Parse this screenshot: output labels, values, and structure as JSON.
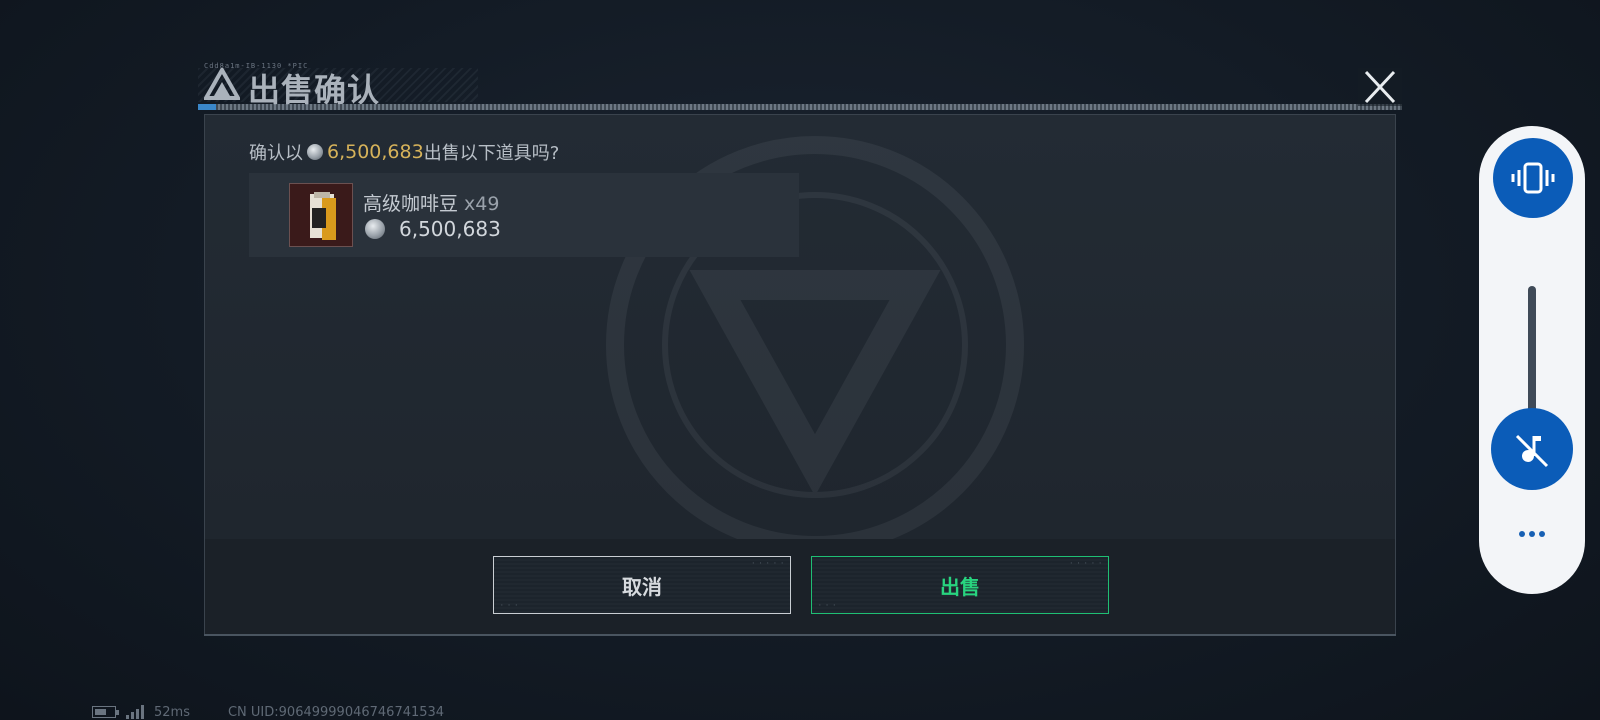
{
  "dialog": {
    "title_tag": "Cdd8a1m-IB-1130 *PIC",
    "title": "出售确认",
    "confirm_prefix": "确认以",
    "confirm_amount": "6,500,683",
    "confirm_suffix": "出售以下道具吗?",
    "item": {
      "name": "高级咖啡豆",
      "quantity": "x49",
      "price": "6,500,683"
    },
    "buttons": {
      "cancel": "取消",
      "sell": "出售"
    },
    "colors": {
      "amount": "#d6b25a",
      "sell_accent": "#28d47f",
      "panel": "#232b34"
    }
  },
  "side_panel": {
    "icons": [
      "vibrate-icon",
      "music-mute-icon",
      "more-icon"
    ],
    "volume_level": 0.3,
    "accent": "#0b5cb8"
  },
  "status_bar": {
    "ping": "52ms",
    "uid": "CN UID:90649999046746741534",
    "battery_level": 0.6
  }
}
